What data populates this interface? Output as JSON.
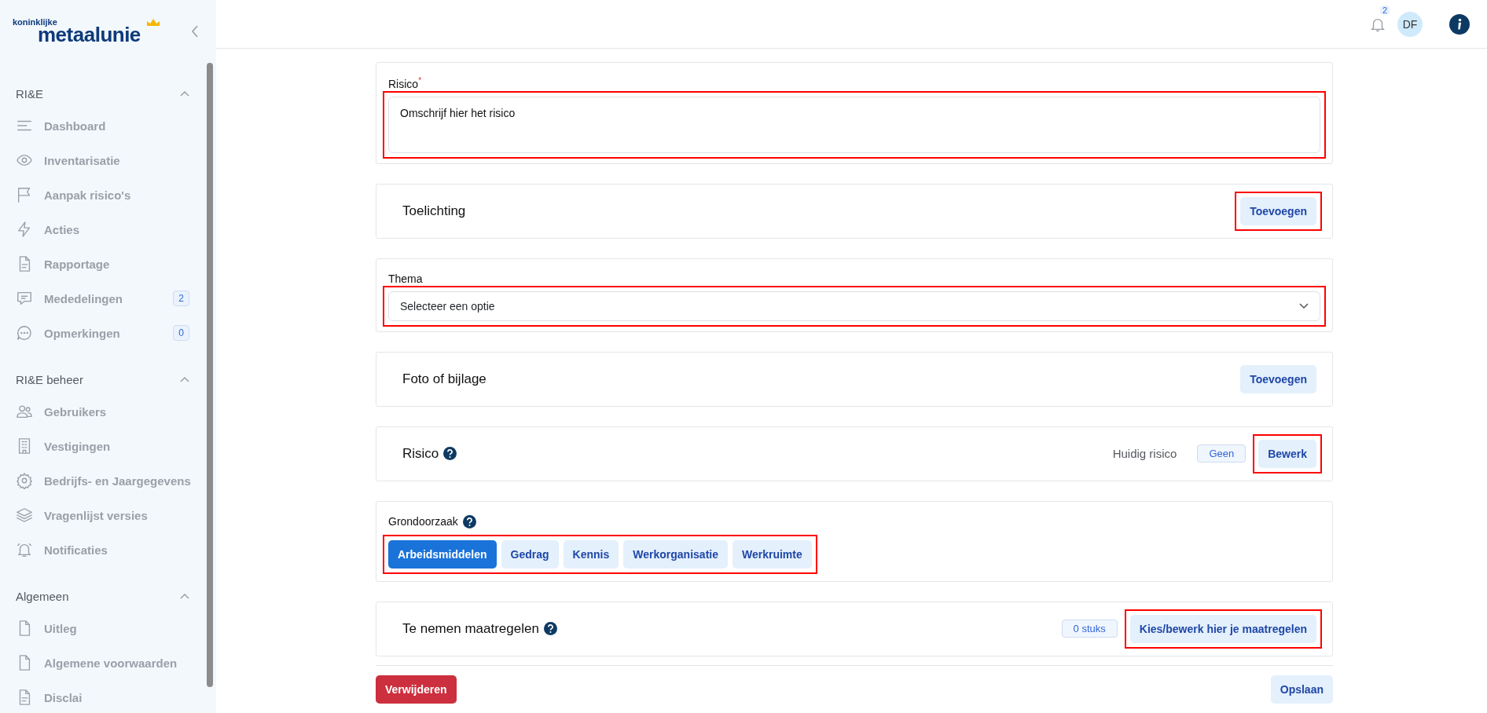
{
  "sidebar": {
    "logo": {
      "top": "koninklijke",
      "main": "metaalunie"
    },
    "sections": [
      {
        "title": "RI&E",
        "expanded": true,
        "items": [
          {
            "label": "Dashboard",
            "kind": "lines"
          },
          {
            "label": "Inventarisatie",
            "kind": "eye"
          },
          {
            "label": "Aanpak risico's",
            "kind": "flag"
          },
          {
            "label": "Acties",
            "kind": "bolt"
          },
          {
            "label": "Rapportage",
            "kind": "doc"
          },
          {
            "label": "Mededelingen",
            "kind": "chat",
            "count": "2"
          },
          {
            "label": "Opmerkingen",
            "kind": "dots",
            "count": "0"
          }
        ]
      },
      {
        "title": "RI&E beheer",
        "expanded": true,
        "items": [
          {
            "label": "Gebruikers",
            "kind": "users"
          },
          {
            "label": "Vestigingen",
            "kind": "building"
          },
          {
            "label": "Bedrijfs- en Jaargegevens",
            "kind": "gear"
          },
          {
            "label": "Vragenlijst versies",
            "kind": "layers"
          },
          {
            "label": "Notificaties",
            "kind": "bell"
          }
        ]
      },
      {
        "title": "Algemeen",
        "expanded": true,
        "items": [
          {
            "label": "Uitleg",
            "kind": "page"
          },
          {
            "label": "Algemene voorwaarden",
            "kind": "page"
          },
          {
            "label": "Disclai",
            "kind": "doc"
          }
        ]
      }
    ]
  },
  "header": {
    "notification_count": "2",
    "avatar": "DF"
  },
  "risk_field": {
    "label": "Risico",
    "required_mark": "*",
    "value": "Omschrijf hier het risico",
    "highlighted": true
  },
  "explanation": {
    "title": "Toelichting",
    "button": "Toevoegen",
    "highlighted": true
  },
  "theme": {
    "label": "Thema",
    "placeholder": "Selecteer een optie",
    "highlighted": true
  },
  "attachment": {
    "title": "Foto of bijlage",
    "button": "Toevoegen",
    "highlighted": false
  },
  "risk": {
    "title": "Risico",
    "current_label": "Huidig risico",
    "current_value": "Geen",
    "button": "Bewerk",
    "highlighted": true
  },
  "root_cause": {
    "label": "Grondoorzaak",
    "highlighted": true,
    "options": [
      {
        "label": "Arbeidsmiddelen",
        "selected": true
      },
      {
        "label": "Gedrag",
        "selected": false
      },
      {
        "label": "Kennis",
        "selected": false
      },
      {
        "label": "Werkorganisatie",
        "selected": false
      },
      {
        "label": "Werkruimte",
        "selected": false
      }
    ]
  },
  "measures": {
    "title": "Te nemen maatregelen",
    "count": "0 stuks",
    "button": "Kies/bewerk hier je maatregelen",
    "highlighted": true
  },
  "actions": {
    "delete": "Verwijderen",
    "save": "Opslaan"
  }
}
